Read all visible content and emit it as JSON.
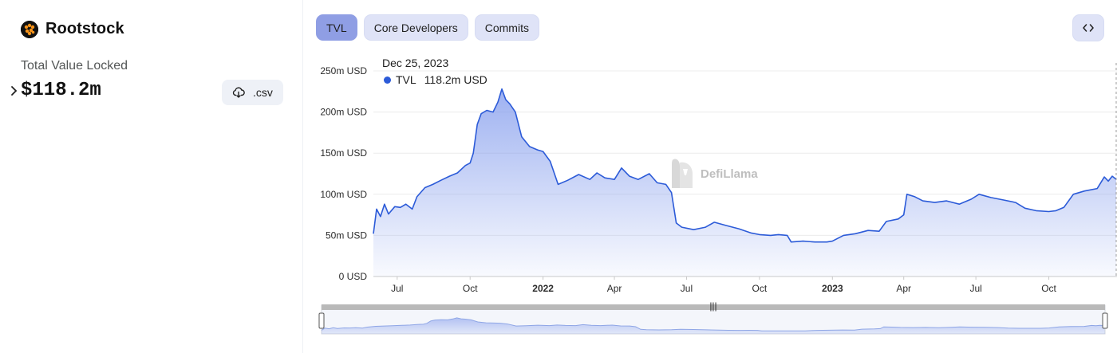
{
  "protocol": {
    "name": "Rootstock",
    "logo_icon": "rootstock-logo-icon"
  },
  "metric": {
    "label": "Total Value Locked",
    "value": "$118.2m"
  },
  "csv_button": {
    "label": ".csv",
    "icon": "cloud-download-icon"
  },
  "tabs": [
    {
      "label": "TVL",
      "active": true
    },
    {
      "label": "Core Developers",
      "active": false
    },
    {
      "label": "Commits",
      "active": false
    }
  ],
  "embed_button": {
    "icon": "code-brackets-icon"
  },
  "tooltip": {
    "date": "Dec 25, 2023",
    "series": "TVL",
    "value": "118.2m USD"
  },
  "watermark": {
    "text": "DefiLlama"
  },
  "colors": {
    "line": "#2c5bd8",
    "fill_top": "#7d97ec",
    "accent_tab": "#8f9ee4",
    "tab_bg": "#dfe3f7"
  },
  "chart_data": {
    "type": "area",
    "series": [
      {
        "name": "TVL",
        "unit": "USD"
      }
    ],
    "y_ticks": [
      "0 USD",
      "50m USD",
      "100m USD",
      "150m USD",
      "200m USD",
      "250m USD"
    ],
    "ylim": [
      0,
      250
    ],
    "y_unit": "m USD",
    "x_ticks": [
      {
        "label": "Jul",
        "date": "2021-07-01",
        "bold": false
      },
      {
        "label": "Oct",
        "date": "2021-10-01",
        "bold": false
      },
      {
        "label": "2022",
        "date": "2022-01-01",
        "bold": true
      },
      {
        "label": "Apr",
        "date": "2022-04-01",
        "bold": false
      },
      {
        "label": "Jul",
        "date": "2022-07-01",
        "bold": false
      },
      {
        "label": "Oct",
        "date": "2022-10-01",
        "bold": false
      },
      {
        "label": "2023",
        "date": "2023-01-01",
        "bold": true
      },
      {
        "label": "Apr",
        "date": "2023-04-01",
        "bold": false
      },
      {
        "label": "Jul",
        "date": "2023-07-01",
        "bold": false
      },
      {
        "label": "Oct",
        "date": "2023-10-01",
        "bold": false
      }
    ],
    "xlim": [
      "2021-06-01",
      "2023-12-25"
    ],
    "points": [
      [
        "2021-06-01",
        52
      ],
      [
        "2021-06-05",
        82
      ],
      [
        "2021-06-10",
        73
      ],
      [
        "2021-06-15",
        88
      ],
      [
        "2021-06-20",
        76
      ],
      [
        "2021-06-28",
        85
      ],
      [
        "2021-07-05",
        84
      ],
      [
        "2021-07-12",
        88
      ],
      [
        "2021-07-20",
        82
      ],
      [
        "2021-07-26",
        97
      ],
      [
        "2021-08-05",
        108
      ],
      [
        "2021-08-15",
        112
      ],
      [
        "2021-08-25",
        117
      ],
      [
        "2021-09-05",
        122
      ],
      [
        "2021-09-15",
        126
      ],
      [
        "2021-09-25",
        135
      ],
      [
        "2021-10-01",
        138
      ],
      [
        "2021-10-05",
        150
      ],
      [
        "2021-10-10",
        185
      ],
      [
        "2021-10-15",
        198
      ],
      [
        "2021-10-22",
        202
      ],
      [
        "2021-10-30",
        200
      ],
      [
        "2021-11-05",
        212
      ],
      [
        "2021-11-10",
        228
      ],
      [
        "2021-11-15",
        215
      ],
      [
        "2021-11-20",
        210
      ],
      [
        "2021-11-27",
        200
      ],
      [
        "2021-12-05",
        170
      ],
      [
        "2021-12-15",
        158
      ],
      [
        "2021-12-25",
        154
      ],
      [
        "2022-01-01",
        152
      ],
      [
        "2022-01-10",
        140
      ],
      [
        "2022-01-20",
        112
      ],
      [
        "2022-02-01",
        117
      ],
      [
        "2022-02-15",
        124
      ],
      [
        "2022-03-01",
        118
      ],
      [
        "2022-03-10",
        126
      ],
      [
        "2022-03-20",
        120
      ],
      [
        "2022-04-01",
        118
      ],
      [
        "2022-04-10",
        132
      ],
      [
        "2022-04-20",
        122
      ],
      [
        "2022-05-01",
        118
      ],
      [
        "2022-05-15",
        125
      ],
      [
        "2022-05-25",
        114
      ],
      [
        "2022-06-05",
        112
      ],
      [
        "2022-06-12",
        102
      ],
      [
        "2022-06-18",
        65
      ],
      [
        "2022-06-25",
        60
      ],
      [
        "2022-07-10",
        57
      ],
      [
        "2022-07-25",
        60
      ],
      [
        "2022-08-05",
        66
      ],
      [
        "2022-08-20",
        62
      ],
      [
        "2022-09-05",
        58
      ],
      [
        "2022-09-20",
        53
      ],
      [
        "2022-10-01",
        51
      ],
      [
        "2022-10-15",
        50
      ],
      [
        "2022-10-25",
        51
      ],
      [
        "2022-11-05",
        50
      ],
      [
        "2022-11-10",
        42
      ],
      [
        "2022-11-25",
        43
      ],
      [
        "2022-12-10",
        42
      ],
      [
        "2022-12-25",
        42
      ],
      [
        "2023-01-01",
        43
      ],
      [
        "2023-01-15",
        50
      ],
      [
        "2023-01-30",
        52
      ],
      [
        "2023-02-15",
        56
      ],
      [
        "2023-03-01",
        55
      ],
      [
        "2023-03-10",
        67
      ],
      [
        "2023-03-25",
        70
      ],
      [
        "2023-04-01",
        75
      ],
      [
        "2023-04-05",
        100
      ],
      [
        "2023-04-15",
        97
      ],
      [
        "2023-04-25",
        92
      ],
      [
        "2023-05-10",
        90
      ],
      [
        "2023-05-25",
        92
      ],
      [
        "2023-06-10",
        88
      ],
      [
        "2023-06-25",
        94
      ],
      [
        "2023-07-05",
        100
      ],
      [
        "2023-07-20",
        96
      ],
      [
        "2023-08-05",
        93
      ],
      [
        "2023-08-20",
        90
      ],
      [
        "2023-09-01",
        83
      ],
      [
        "2023-09-15",
        80
      ],
      [
        "2023-10-01",
        79
      ],
      [
        "2023-10-10",
        80
      ],
      [
        "2023-10-20",
        84
      ],
      [
        "2023-11-01",
        100
      ],
      [
        "2023-11-15",
        104
      ],
      [
        "2023-12-01",
        107
      ],
      [
        "2023-12-10",
        121
      ],
      [
        "2023-12-15",
        116
      ],
      [
        "2023-12-20",
        122
      ],
      [
        "2023-12-25",
        118.2
      ]
    ]
  }
}
